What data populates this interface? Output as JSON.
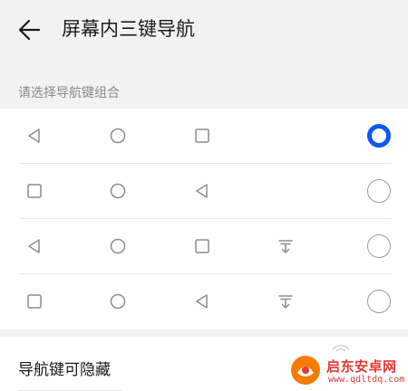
{
  "header": {
    "title": "屏幕内三键导航",
    "back_icon": "arrow-left-icon"
  },
  "section": {
    "label": "请选择导航键组合"
  },
  "options": [
    {
      "icons": [
        "back-triangle-icon",
        "home-circle-icon",
        "recent-square-icon"
      ],
      "selected": true
    },
    {
      "icons": [
        "recent-square-icon",
        "home-circle-icon",
        "back-triangle-icon"
      ],
      "selected": false
    },
    {
      "icons": [
        "back-triangle-icon",
        "home-circle-icon",
        "recent-square-icon",
        "notification-pull-icon"
      ],
      "selected": false
    },
    {
      "icons": [
        "recent-square-icon",
        "home-circle-icon",
        "back-triangle-icon",
        "notification-pull-icon"
      ],
      "selected": false
    }
  ],
  "hideable": {
    "label": "导航键可隐藏"
  },
  "watermark": {
    "text": "启东安卓网",
    "url": "www.qdltdq.com"
  },
  "colors": {
    "accent": "#0a59f7",
    "background": "#f2f2f2",
    "icon_gray": "#8c8c8c",
    "watermark_red": "#e53935"
  }
}
